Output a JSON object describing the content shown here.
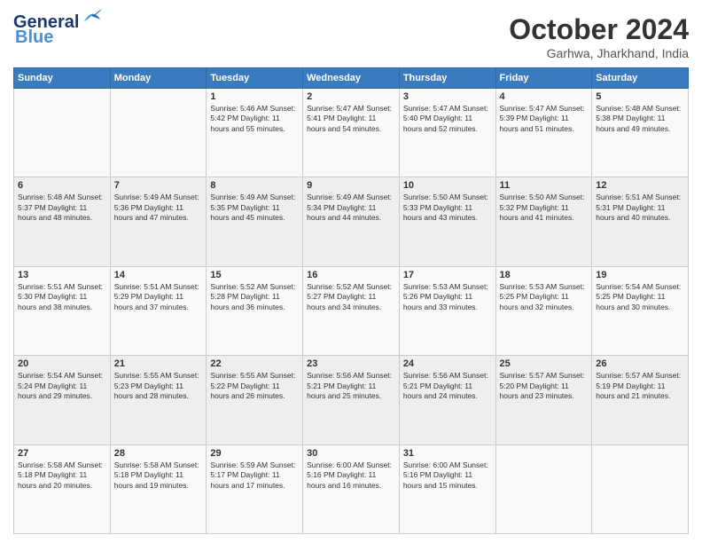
{
  "header": {
    "logo_line1": "General",
    "logo_line2": "Blue",
    "month_title": "October 2024",
    "location": "Garhwa, Jharkhand, India"
  },
  "days_of_week": [
    "Sunday",
    "Monday",
    "Tuesday",
    "Wednesday",
    "Thursday",
    "Friday",
    "Saturday"
  ],
  "weeks": [
    [
      {
        "day": "",
        "info": ""
      },
      {
        "day": "",
        "info": ""
      },
      {
        "day": "1",
        "info": "Sunrise: 5:46 AM\nSunset: 5:42 PM\nDaylight: 11 hours and 55 minutes."
      },
      {
        "day": "2",
        "info": "Sunrise: 5:47 AM\nSunset: 5:41 PM\nDaylight: 11 hours and 54 minutes."
      },
      {
        "day": "3",
        "info": "Sunrise: 5:47 AM\nSunset: 5:40 PM\nDaylight: 11 hours and 52 minutes."
      },
      {
        "day": "4",
        "info": "Sunrise: 5:47 AM\nSunset: 5:39 PM\nDaylight: 11 hours and 51 minutes."
      },
      {
        "day": "5",
        "info": "Sunrise: 5:48 AM\nSunset: 5:38 PM\nDaylight: 11 hours and 49 minutes."
      }
    ],
    [
      {
        "day": "6",
        "info": "Sunrise: 5:48 AM\nSunset: 5:37 PM\nDaylight: 11 hours and 48 minutes."
      },
      {
        "day": "7",
        "info": "Sunrise: 5:49 AM\nSunset: 5:36 PM\nDaylight: 11 hours and 47 minutes."
      },
      {
        "day": "8",
        "info": "Sunrise: 5:49 AM\nSunset: 5:35 PM\nDaylight: 11 hours and 45 minutes."
      },
      {
        "day": "9",
        "info": "Sunrise: 5:49 AM\nSunset: 5:34 PM\nDaylight: 11 hours and 44 minutes."
      },
      {
        "day": "10",
        "info": "Sunrise: 5:50 AM\nSunset: 5:33 PM\nDaylight: 11 hours and 43 minutes."
      },
      {
        "day": "11",
        "info": "Sunrise: 5:50 AM\nSunset: 5:32 PM\nDaylight: 11 hours and 41 minutes."
      },
      {
        "day": "12",
        "info": "Sunrise: 5:51 AM\nSunset: 5:31 PM\nDaylight: 11 hours and 40 minutes."
      }
    ],
    [
      {
        "day": "13",
        "info": "Sunrise: 5:51 AM\nSunset: 5:30 PM\nDaylight: 11 hours and 38 minutes."
      },
      {
        "day": "14",
        "info": "Sunrise: 5:51 AM\nSunset: 5:29 PM\nDaylight: 11 hours and 37 minutes."
      },
      {
        "day": "15",
        "info": "Sunrise: 5:52 AM\nSunset: 5:28 PM\nDaylight: 11 hours and 36 minutes."
      },
      {
        "day": "16",
        "info": "Sunrise: 5:52 AM\nSunset: 5:27 PM\nDaylight: 11 hours and 34 minutes."
      },
      {
        "day": "17",
        "info": "Sunrise: 5:53 AM\nSunset: 5:26 PM\nDaylight: 11 hours and 33 minutes."
      },
      {
        "day": "18",
        "info": "Sunrise: 5:53 AM\nSunset: 5:25 PM\nDaylight: 11 hours and 32 minutes."
      },
      {
        "day": "19",
        "info": "Sunrise: 5:54 AM\nSunset: 5:25 PM\nDaylight: 11 hours and 30 minutes."
      }
    ],
    [
      {
        "day": "20",
        "info": "Sunrise: 5:54 AM\nSunset: 5:24 PM\nDaylight: 11 hours and 29 minutes."
      },
      {
        "day": "21",
        "info": "Sunrise: 5:55 AM\nSunset: 5:23 PM\nDaylight: 11 hours and 28 minutes."
      },
      {
        "day": "22",
        "info": "Sunrise: 5:55 AM\nSunset: 5:22 PM\nDaylight: 11 hours and 26 minutes."
      },
      {
        "day": "23",
        "info": "Sunrise: 5:56 AM\nSunset: 5:21 PM\nDaylight: 11 hours and 25 minutes."
      },
      {
        "day": "24",
        "info": "Sunrise: 5:56 AM\nSunset: 5:21 PM\nDaylight: 11 hours and 24 minutes."
      },
      {
        "day": "25",
        "info": "Sunrise: 5:57 AM\nSunset: 5:20 PM\nDaylight: 11 hours and 23 minutes."
      },
      {
        "day": "26",
        "info": "Sunrise: 5:57 AM\nSunset: 5:19 PM\nDaylight: 11 hours and 21 minutes."
      }
    ],
    [
      {
        "day": "27",
        "info": "Sunrise: 5:58 AM\nSunset: 5:18 PM\nDaylight: 11 hours and 20 minutes."
      },
      {
        "day": "28",
        "info": "Sunrise: 5:58 AM\nSunset: 5:18 PM\nDaylight: 11 hours and 19 minutes."
      },
      {
        "day": "29",
        "info": "Sunrise: 5:59 AM\nSunset: 5:17 PM\nDaylight: 11 hours and 17 minutes."
      },
      {
        "day": "30",
        "info": "Sunrise: 6:00 AM\nSunset: 5:16 PM\nDaylight: 11 hours and 16 minutes."
      },
      {
        "day": "31",
        "info": "Sunrise: 6:00 AM\nSunset: 5:16 PM\nDaylight: 11 hours and 15 minutes."
      },
      {
        "day": "",
        "info": ""
      },
      {
        "day": "",
        "info": ""
      }
    ]
  ]
}
